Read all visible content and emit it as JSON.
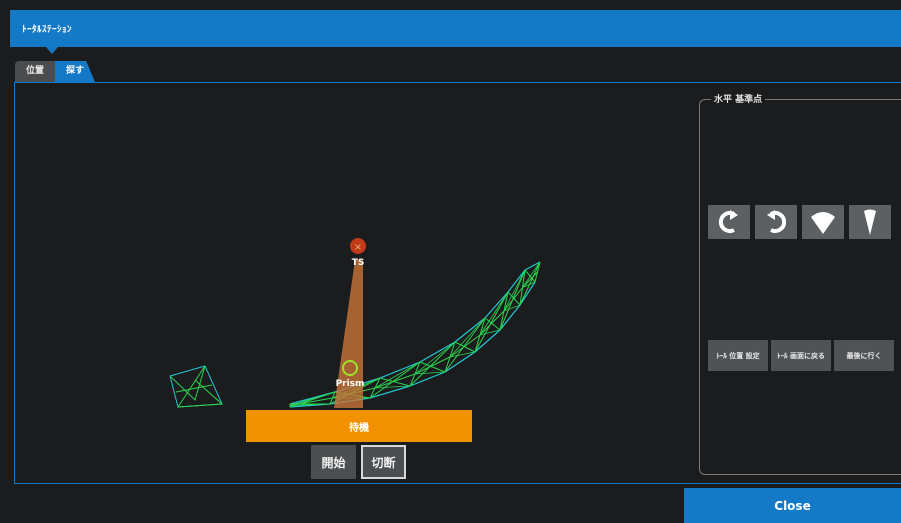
{
  "app": {
    "title": "ﾄｰﾀﾙｽﾃｰｼｮﾝ"
  },
  "tabs": [
    {
      "label": "位置"
    },
    {
      "label": "探す"
    }
  ],
  "scene": {
    "ts_label": "TS",
    "prism_label": "Prism"
  },
  "horizontal_panel": {
    "title": "水平 基準点",
    "icon_buttons": [
      {
        "icon": "rotate-left-icon"
      },
      {
        "icon": "rotate-right-icon"
      },
      {
        "icon": "wide-beam-icon"
      },
      {
        "icon": "narrow-beam-icon"
      }
    ],
    "text_buttons": [
      {
        "label": "ﾄｰﾙ 位置 設定"
      },
      {
        "label": "ﾄｰﾙ 画面に戻る"
      },
      {
        "label": "最後に行く"
      }
    ]
  },
  "status": {
    "label": "待機"
  },
  "controls": {
    "start_label": "開始",
    "cut_label": "切断"
  },
  "footer": {
    "close_label": "Close"
  },
  "colors": {
    "accent": "#1479c6",
    "standby": "#f39200",
    "mesh": "#2bd44f",
    "mesh_edge": "#22c7d4"
  }
}
